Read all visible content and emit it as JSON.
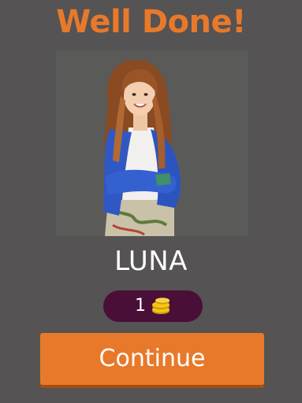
{
  "result": {
    "title": "Well Done!",
    "answer": "LUNA"
  },
  "reward": {
    "coins": "1",
    "icon": "coin-stack-icon",
    "coin_color": "#F5C518"
  },
  "actions": {
    "continue_label": "Continue"
  },
  "colors": {
    "background": "#555353",
    "accent": "#E8792A",
    "reward_pill": "#4A0F36"
  }
}
